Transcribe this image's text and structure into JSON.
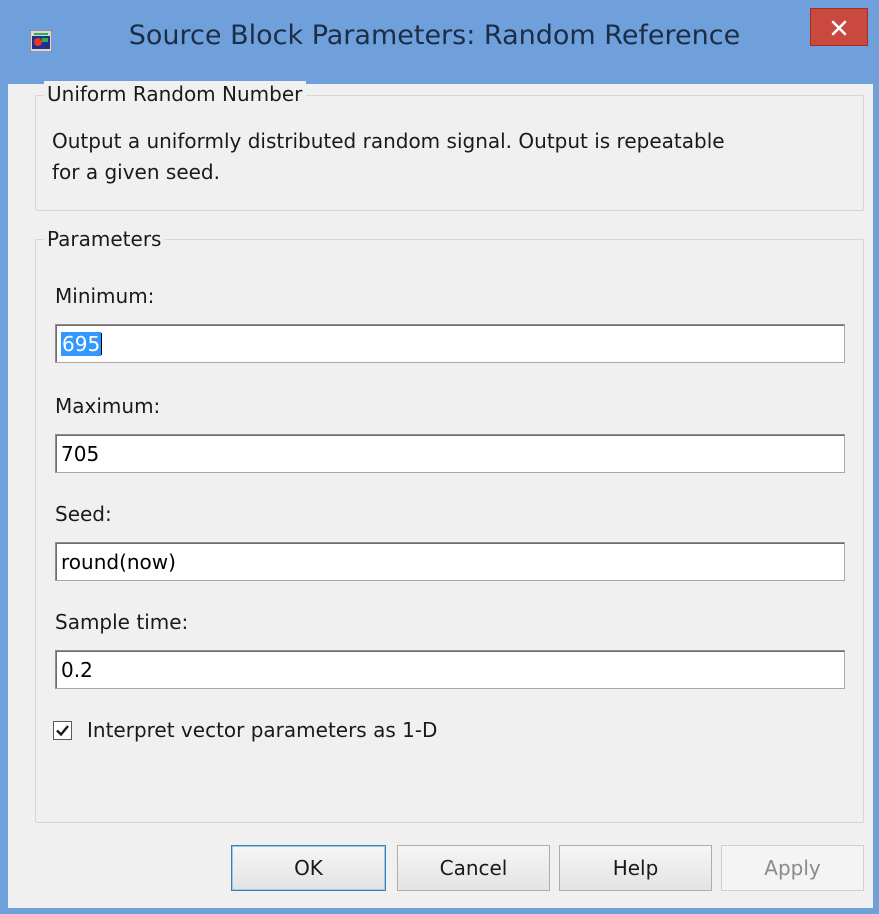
{
  "window": {
    "title": "Source Block Parameters: Random Reference",
    "icon": "simulink-block-icon",
    "close_icon": "close-icon"
  },
  "description_group": {
    "legend": "Uniform Random Number",
    "text_line1": "Output a uniformly distributed random signal.  Output is repeatable",
    "text_line2": "for a given seed."
  },
  "parameters": {
    "legend": "Parameters",
    "minimum": {
      "label": "Minimum:",
      "value": "695"
    },
    "maximum": {
      "label": "Maximum:",
      "value": "705"
    },
    "seed": {
      "label": "Seed:",
      "value": "round(now)"
    },
    "sample_time": {
      "label": "Sample time:",
      "value": "0.2"
    },
    "interpret_vector": {
      "label": "Interpret vector parameters as 1-D",
      "checked": true
    }
  },
  "buttons": {
    "ok": "OK",
    "cancel": "Cancel",
    "help": "Help",
    "apply": "Apply"
  }
}
